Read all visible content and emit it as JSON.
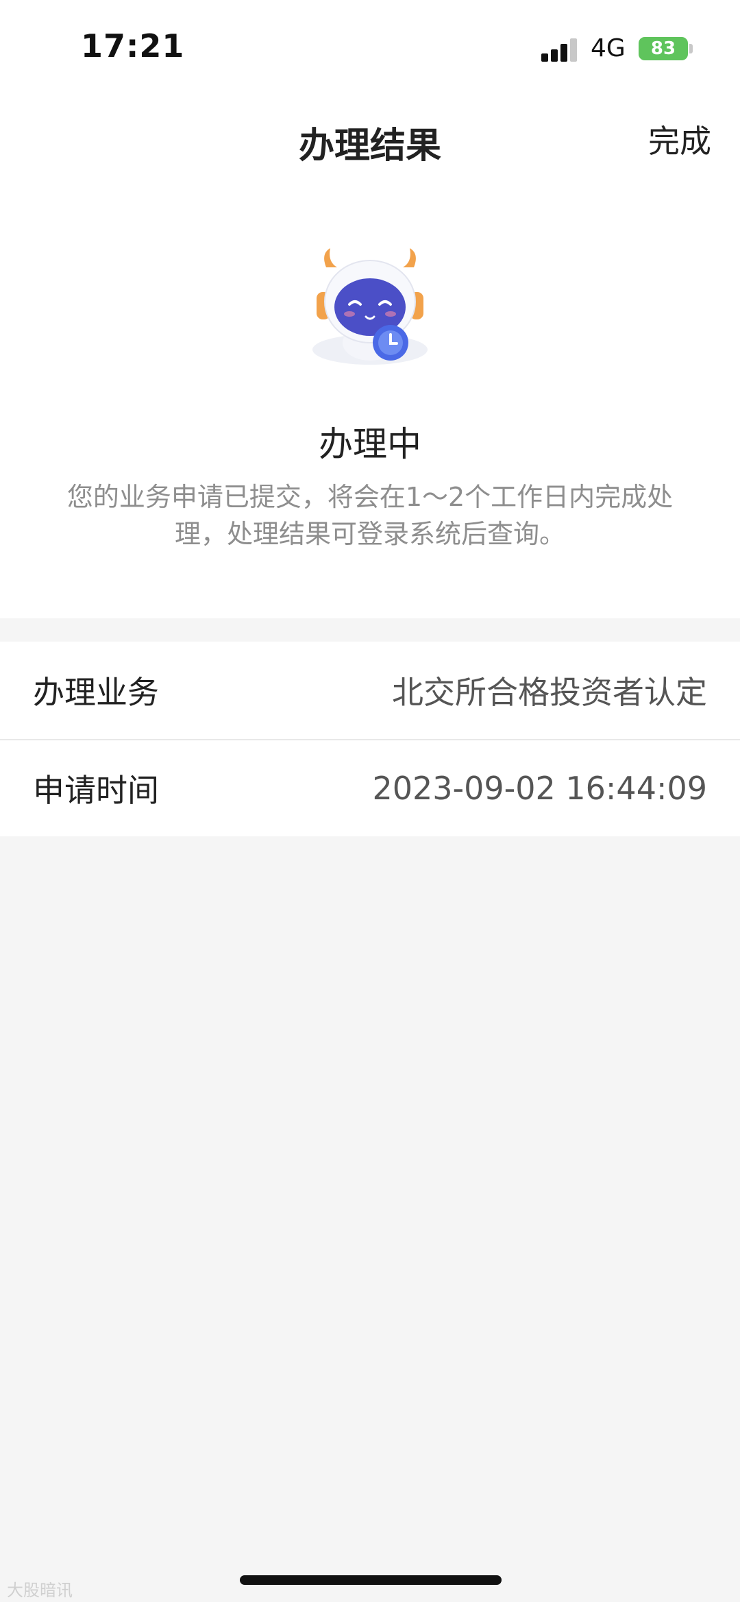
{
  "status_bar": {
    "time": "17:21",
    "network": "4G",
    "battery": "83"
  },
  "nav": {
    "title": "办理结果",
    "done_label": "完成"
  },
  "result": {
    "status_title": "办理中",
    "description": "您的业务申请已提交，将会在1～2个工作日内完成处理，处理结果可登录系统后查询。"
  },
  "info_rows": [
    {
      "label": "办理业务",
      "value": "北交所合格投资者认定"
    },
    {
      "label": "申请时间",
      "value": "2023-09-02 16:44:09"
    }
  ],
  "watermark": "大股暗讯",
  "colors": {
    "background": "#f5f5f5",
    "card": "#ffffff",
    "battery": "#5fc45c",
    "muted_text": "#8e8e8e",
    "mascot_face": "#4b4fc7",
    "mascot_horn": "#f2a24b"
  },
  "icons": {
    "signal": "cellular-signal-icon",
    "battery": "battery-charging-icon",
    "mascot": "robot-mascot-with-clock-icon"
  }
}
